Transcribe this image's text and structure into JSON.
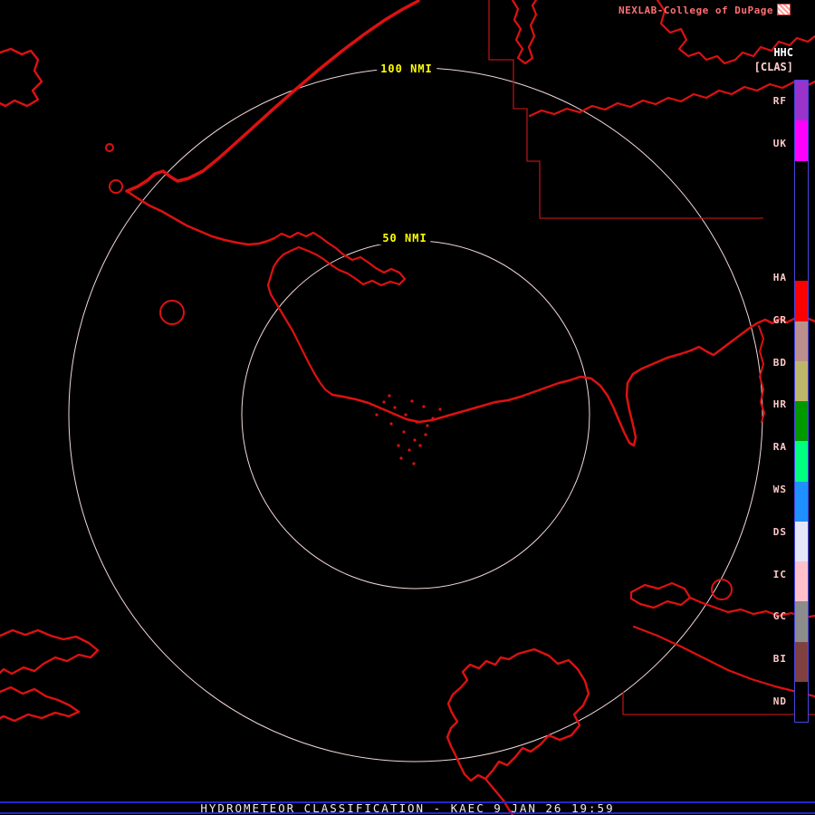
{
  "header": {
    "brand": "NEXLAB-College of DuPage",
    "product_code": "HHC",
    "mode": "[CLAS]"
  },
  "map": {
    "radar_site": "KAEC",
    "range_rings": [
      {
        "label": "100 NMI"
      },
      {
        "label": "50 NMI"
      }
    ],
    "ring_color": "#f4d8d8",
    "ring_label_color": "#ffff00",
    "coastline_color": "#dd1111",
    "boundary_color": "#b51212"
  },
  "legend": {
    "border_color": "#4646e0",
    "label_color": "#ffc8c8",
    "slots": [
      {
        "label": "RF",
        "color": "#9933CC"
      },
      {
        "label": "UK",
        "color": "#FF00FF"
      },
      {
        "label": "",
        "color": "#000000"
      },
      {
        "label": "",
        "color": "#000000"
      },
      {
        "label": "",
        "color": "#000000"
      },
      {
        "label": "HA",
        "color": "#FF0000"
      },
      {
        "label": "GR",
        "color": "#BC8F8F"
      },
      {
        "label": "BD",
        "color": "#BDB76B"
      },
      {
        "label": "HR",
        "color": "#009900"
      },
      {
        "label": "RA",
        "color": "#00FF7F"
      },
      {
        "label": "WS",
        "color": "#1E90FF"
      },
      {
        "label": "DS",
        "color": "#E6E6FA"
      },
      {
        "label": "IC",
        "color": "#FFC0CB"
      },
      {
        "label": "GC",
        "color": "#8C8C8C"
      },
      {
        "label": "BI",
        "color": "#804040"
      },
      {
        "label": "ND",
        "color": "#000000"
      }
    ]
  },
  "statusbar": {
    "text": "HYDROMETEOR CLASSIFICATION - KAEC 9 JAN 26 19:59",
    "line_color": "#2525cc",
    "text_color": "#ededed"
  }
}
